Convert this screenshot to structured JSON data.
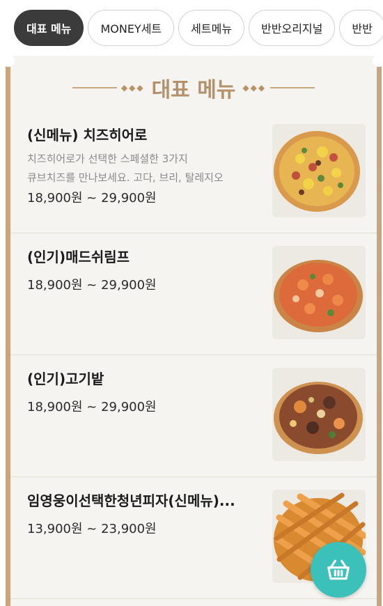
{
  "tabs": [
    {
      "label": "대표 메뉴",
      "active": true
    },
    {
      "label": "MONEY세트",
      "active": false
    },
    {
      "label": "세트메뉴",
      "active": false
    },
    {
      "label": "반반오리지널",
      "active": false
    },
    {
      "label": "반반",
      "active": false
    }
  ],
  "section": {
    "title": "대표 메뉴"
  },
  "items": [
    {
      "name": "(신메뉴) 치즈히어로",
      "desc_line1": "치즈히어로가 선택한 스페셜한 3가지",
      "desc_line2": "큐브치즈를 만나보세요. 고다, 브리, 탈레지오",
      "price": "18,900원 ~ 29,900원",
      "image": "cheese-hero-pizza-photo"
    },
    {
      "name": "(인기)매드쉬림프",
      "price": "18,900원 ~ 29,900원",
      "image": "mad-shrimp-pizza-photo"
    },
    {
      "name": "(인기)고기밭",
      "price": "18,900원 ~ 29,900원",
      "image": "meat-field-pizza-photo"
    },
    {
      "name": "임영웅이선택한청년피자(신메뉴)...",
      "price": "13,900원 ~ 23,900원",
      "image": "youth-pizza-photo"
    }
  ],
  "cart": {
    "icon": "basket-icon",
    "color": "#3cc1ba"
  },
  "colors": {
    "accent": "#c8a57e",
    "active_tab": "#3b3b3b",
    "title": "#b4916a"
  }
}
